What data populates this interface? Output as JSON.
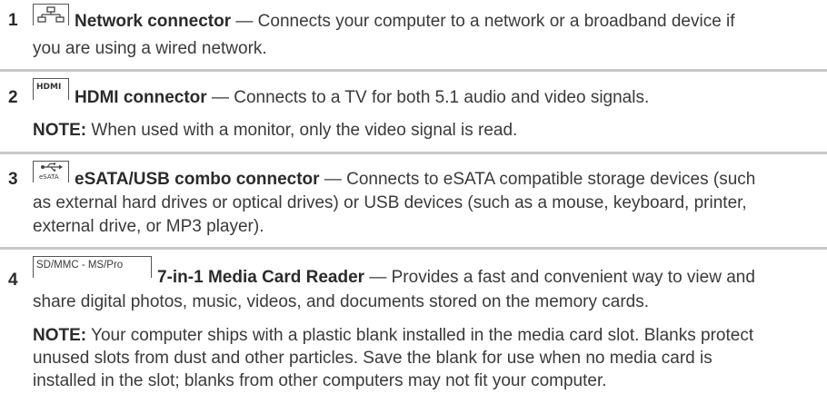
{
  "entries": [
    {
      "number": "1",
      "icon": "network-icon",
      "title": "Network connector",
      "desc_line1": " — Connects your computer to a network or a broadband device if",
      "desc_line2": "you are using a wired network."
    },
    {
      "number": "2",
      "icon": "hdmi-icon",
      "title": "HDMI connector",
      "desc_line1": " — Connects to a TV for both 5.1 audio and video signals.",
      "note_label": "NOTE:",
      "note_line1": " When used with a monitor, only the video signal is read."
    },
    {
      "number": "3",
      "icon": "esata-usb-icon",
      "icon_text": "eSATA",
      "title": "eSATA/USB combo connector",
      "desc_line1": " — Connects to eSATA compatible storage devices (such",
      "desc_line2": "as external hard drives or optical drives) or USB devices (such as a mouse, keyboard, printer,",
      "desc_line3": "external drive, or MP3 player)."
    },
    {
      "number": "4",
      "icon": "media-card-icon",
      "icon_text": "SD/MMC - MS/Pro",
      "title": "7-in-1 Media Card Reader",
      "desc_line1": " — Provides a fast and convenient way to view and",
      "desc_line2": "share digital photos, music, videos, and documents stored on the memory cards.",
      "note_label": "NOTE:",
      "note_line1": " Your computer ships with a plastic blank installed in the media card slot. Blanks protect",
      "note_line2": "unused slots from dust and other particles. Save the blank for use when no media card is",
      "note_line3": "installed in the slot; blanks from other computers may not fit your computer."
    }
  ],
  "colors": {
    "rule": "#c8c8c8",
    "text": "#3a3a3a",
    "bold": "#2b2b2b"
  }
}
